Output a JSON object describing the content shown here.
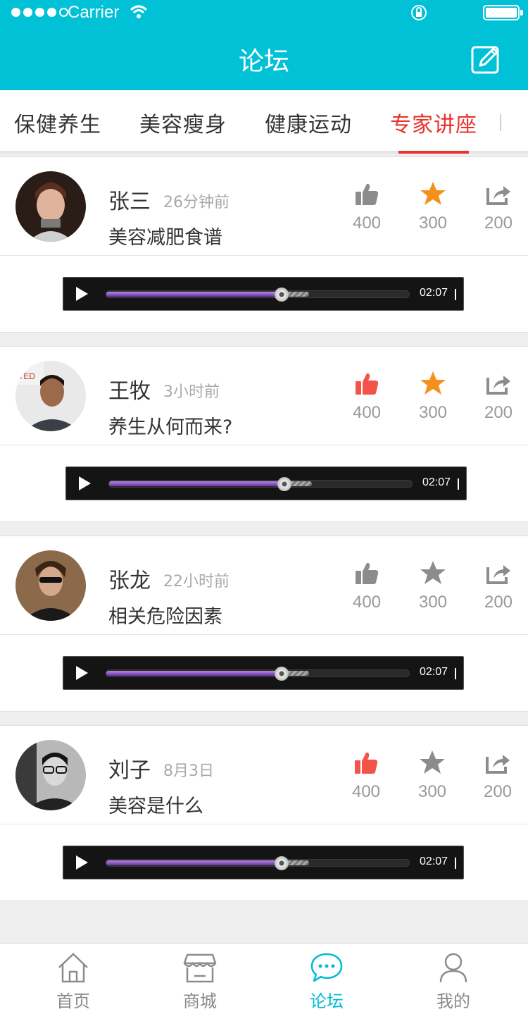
{
  "status_bar": {
    "carrier": "Carrier"
  },
  "header": {
    "title": "论坛"
  },
  "tabs": [
    {
      "label": "保健养生",
      "active": false
    },
    {
      "label": "美容瘦身",
      "active": false
    },
    {
      "label": "健康运动",
      "active": false
    },
    {
      "label": "专家讲座",
      "active": true
    }
  ],
  "posts": [
    {
      "author": "张三",
      "time": "26分钟前",
      "subject": "美容减肥食谱",
      "likes": "400",
      "favorites": "300",
      "shares": "200",
      "liked": false,
      "favorited": true,
      "audio_time": "02:07",
      "progress": 0.58
    },
    {
      "author": "王牧",
      "time": "3小时前",
      "subject": "养生从何而来?",
      "likes": "400",
      "favorites": "300",
      "shares": "200",
      "liked": true,
      "favorited": true,
      "audio_time": "02:07",
      "progress": 0.58
    },
    {
      "author": "张龙",
      "time": "22小时前",
      "subject": "相关危险因素",
      "likes": "400",
      "favorites": "300",
      "shares": "200",
      "liked": false,
      "favorited": false,
      "audio_time": "02:07",
      "progress": 0.58
    },
    {
      "author": "刘子",
      "time": "8月3日",
      "subject": "美容是什么",
      "likes": "400",
      "favorites": "300",
      "shares": "200",
      "liked": true,
      "favorited": false,
      "audio_time": "02:07",
      "progress": 0.58
    }
  ],
  "bottom_nav": [
    {
      "label": "首页",
      "icon": "home-icon",
      "active": false
    },
    {
      "label": "商城",
      "icon": "store-icon",
      "active": false
    },
    {
      "label": "论坛",
      "icon": "chat-icon",
      "active": true
    },
    {
      "label": "我的",
      "icon": "person-icon",
      "active": false
    }
  ],
  "colors": {
    "header": "#00c1d6",
    "active_tab": "#e8322c",
    "liked": "#f2544a",
    "favorited": "#f5901e",
    "inactive_icon": "#8c8c8c",
    "nav_active": "#00bcd4"
  }
}
